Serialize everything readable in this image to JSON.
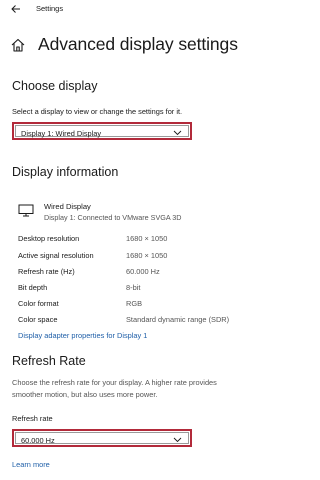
{
  "titlebar": {
    "title": "Settings",
    "back_icon": "back-arrow-icon"
  },
  "header": {
    "title": "Advanced display settings",
    "home_icon": "home-icon"
  },
  "choose_display": {
    "heading": "Choose display",
    "description": "Select a display to view or change the settings for it.",
    "selected": "Display 1: Wired Display"
  },
  "display_information": {
    "heading": "Display information",
    "display_name": "Wired Display",
    "display_connection": "Display 1: Connected to VMware SVGA 3D",
    "rows": [
      {
        "label": "Desktop resolution",
        "value": "1680 × 1050"
      },
      {
        "label": "Active signal resolution",
        "value": "1680 × 1050"
      },
      {
        "label": "Refresh rate (Hz)",
        "value": "60.000 Hz"
      },
      {
        "label": "Bit depth",
        "value": "8-bit"
      },
      {
        "label": "Color format",
        "value": "RGB"
      },
      {
        "label": "Color space",
        "value": "Standard dynamic range (SDR)"
      }
    ],
    "adapter_link": "Display adapter properties for Display 1"
  },
  "refresh_rate": {
    "heading": "Refresh Rate",
    "description_line1": "Choose the refresh rate for your display. A higher rate provides",
    "description_line2": "smoother motion, but also uses more power.",
    "field_label": "Refresh rate",
    "selected": "60.000 Hz",
    "learn_more": "Learn more"
  },
  "colors": {
    "highlight_border": "#b22a3a",
    "link": "#1f5fa8"
  }
}
